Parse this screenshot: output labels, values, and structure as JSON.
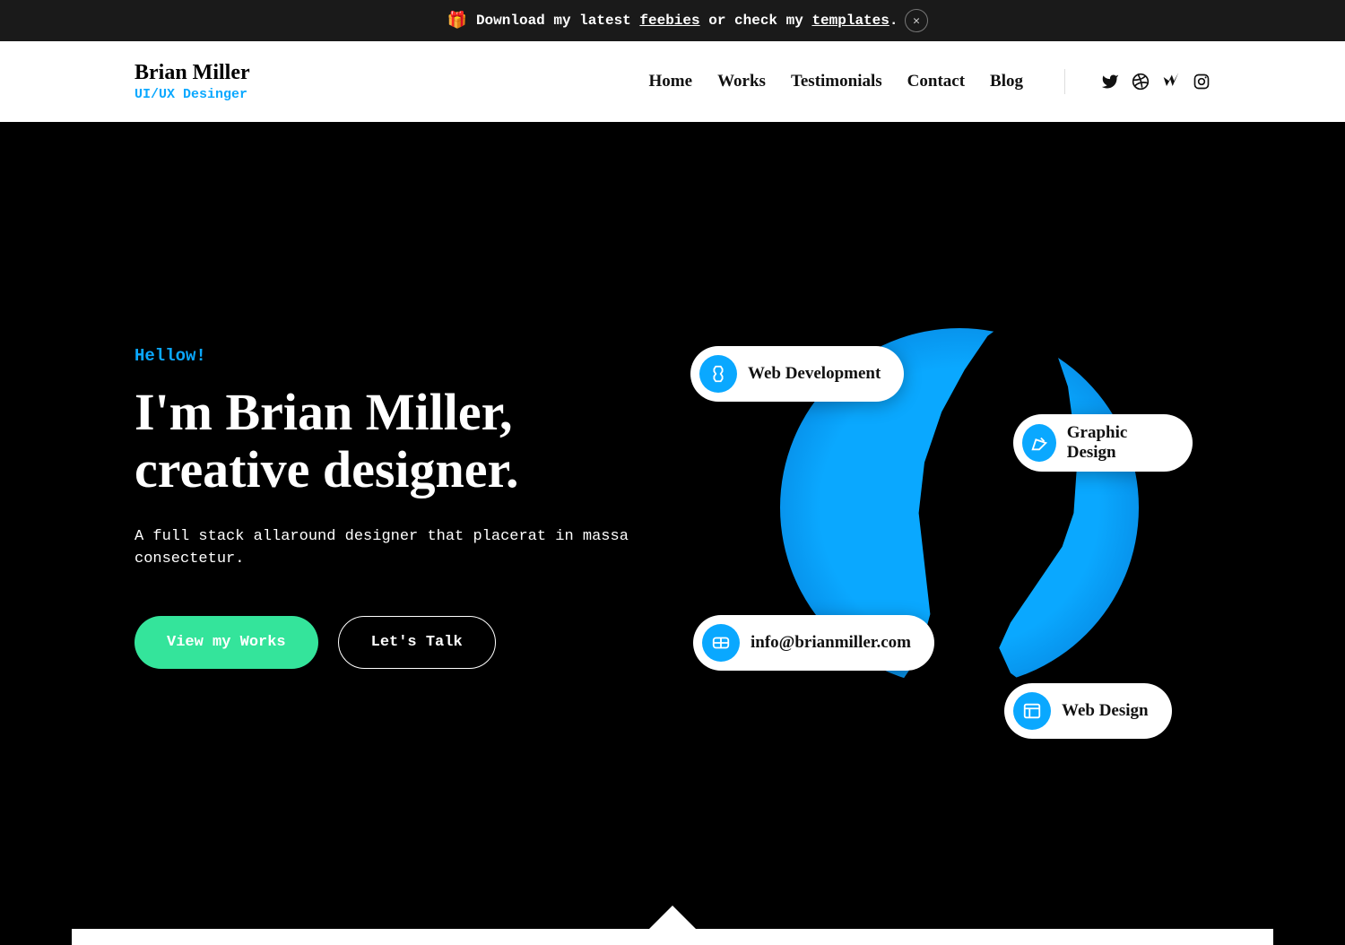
{
  "banner": {
    "prefix": "Download my latest ",
    "link1": "feebies",
    "mid": " or check my ",
    "link2": "templates",
    "suffix": "."
  },
  "brand": {
    "name": "Brian Miller",
    "role": "UI/UX Desinger"
  },
  "nav": {
    "items": [
      "Home",
      "Works",
      "Testimonials",
      "Contact",
      "Blog"
    ]
  },
  "hero": {
    "greet": "Hellow!",
    "title_line1": "I'm Brian Miller,",
    "title_line2": "creative designer.",
    "subtitle": "A full stack allaround designer that placerat in massa consectetur.",
    "btn_primary": "View my Works",
    "btn_secondary": "Let's Talk",
    "chips": {
      "c1": "Web Development",
      "c2": "Graphic Design",
      "c3": "info@brianmiller.com",
      "c4": "Web Design"
    }
  },
  "colors": {
    "accent_blue": "#0aa8ff",
    "accent_green": "#34e49b"
  }
}
